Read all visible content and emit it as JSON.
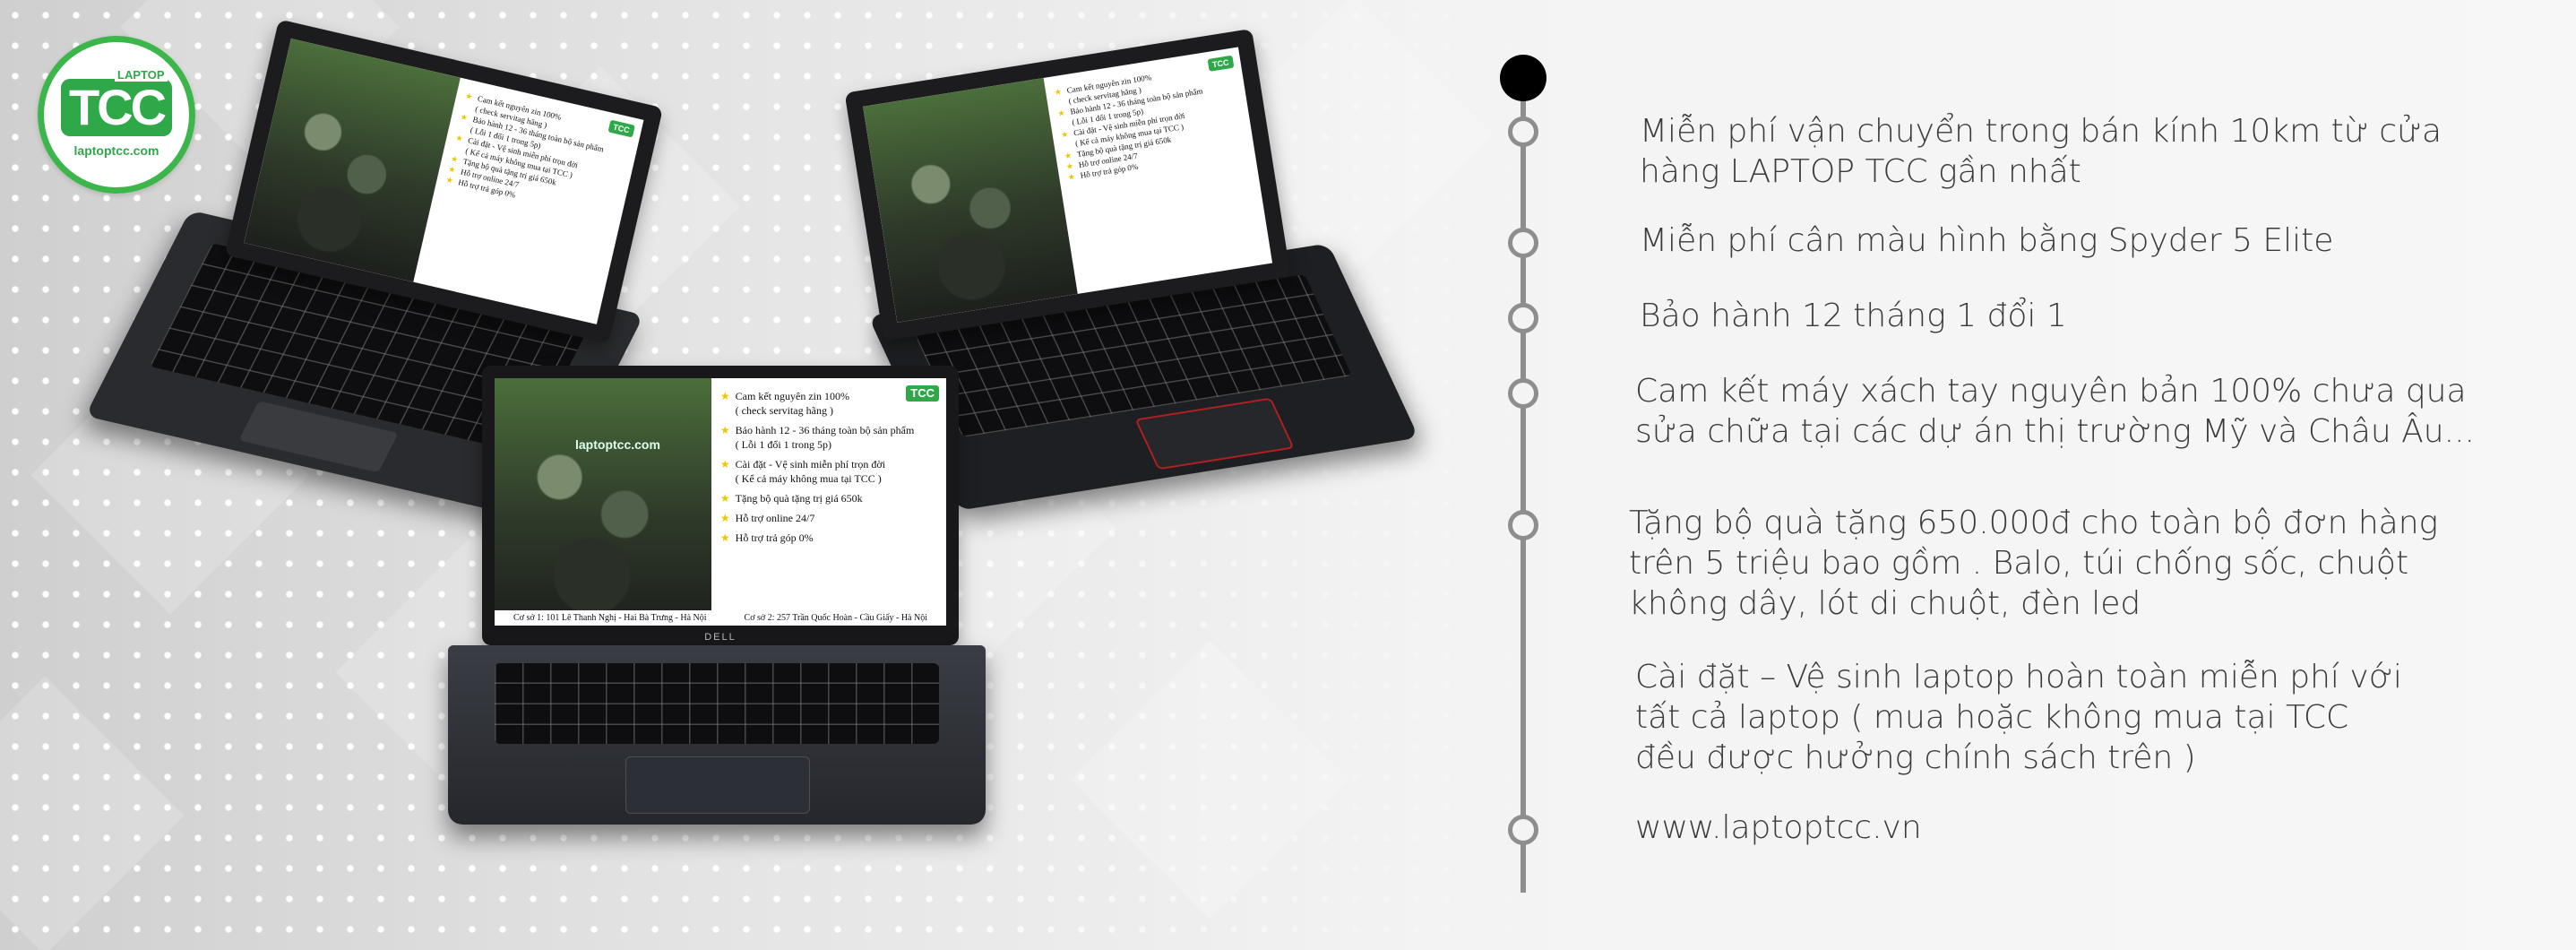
{
  "logo": {
    "badge": "LAPTOP",
    "name": "TCC",
    "url": "laptoptcc.com"
  },
  "screen": {
    "brand": "TCC",
    "items": [
      "Cam kết nguyên zin 100%\n( check servitag hãng )",
      "Bảo hành 12 - 36 tháng toàn bộ sản phẩm\n( Lỗi 1 đổi 1 trong 5p)",
      "Cài đặt - Vệ sinh miễn phí trọn đời\n( Kể cả máy không mua tại TCC )",
      "Tặng bộ quà tặng trị giá 650k",
      "Hỗ trợ online 24/7",
      "Hỗ trợ trả góp 0%"
    ],
    "address_1": "Cơ sở 1: 101 Lê Thanh Nghị - Hai Bà Trưng - Hà Nội",
    "address_2": "Cơ sở 2: 257 Trần Quốc Hoàn - Cầu Giấy - Hà Nội",
    "photo_sign": "laptoptcc.com"
  },
  "laptop_brand": "DELL",
  "features": [
    "Miễn phí vận chuyển trong bán kính 10km từ cửa\nhàng LAPTOP TCC gần nhất",
    "Miễn phí cân màu hình bằng Spyder 5 Elite",
    "Bảo hành 12 tháng 1 đổi 1",
    "Cam kết máy xách tay nguyên bản 100% chưa qua\nsửa chữa tại các dự án thị trường Mỹ và Châu Âu...",
    "Tặng bộ quà tặng 650.000đ cho toàn bộ đơn hàng\ntrên 5 triệu bao gồm . Balo, túi chống sốc, chuột\nkhông dây, lót di chuột, đèn led",
    "Cài đặt – Vệ sinh laptop hoàn toàn miễn phí với\ntất cả laptop ( mua hoặc không mua tại TCC\nđều được hưởng chính sách trên )",
    "www.laptoptcc.vn"
  ],
  "colors": {
    "brand_green": "#2fa84a",
    "timeline_gray": "#8e8e8e",
    "text_gray": "#3a3a3a"
  }
}
